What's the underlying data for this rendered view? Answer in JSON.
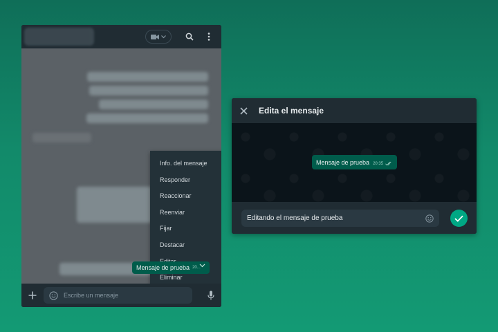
{
  "colors": {
    "background_green": "#128a6a",
    "panel": "#202c33",
    "chat_bg": "#0b141a",
    "outgoing_bubble": "#005c4b",
    "accent": "#00a884",
    "menu_bg": "#233138"
  },
  "chat": {
    "header": {
      "contact_name_blurred": "",
      "icons": [
        "video-call-icon",
        "search-icon",
        "menu-dots-icon"
      ]
    },
    "context_menu": {
      "items": [
        {
          "label": "Info. del mensaje"
        },
        {
          "label": "Responder"
        },
        {
          "label": "Reaccionar"
        },
        {
          "label": "Reenviar"
        },
        {
          "label": "Fijar"
        },
        {
          "label": "Destacar"
        },
        {
          "label": "Editar"
        },
        {
          "label": "Eliminar"
        }
      ]
    },
    "selected_message": {
      "text": "Mensaje de prueba",
      "time": "20..."
    },
    "footer": {
      "placeholder": "Escribe un mensaje"
    }
  },
  "edit_dialog": {
    "title": "Edita el mensaje",
    "preview_message": {
      "text": "Mensaje de prueba",
      "time": "20:35"
    },
    "input_value": "Editando el mensaje de prueba"
  }
}
